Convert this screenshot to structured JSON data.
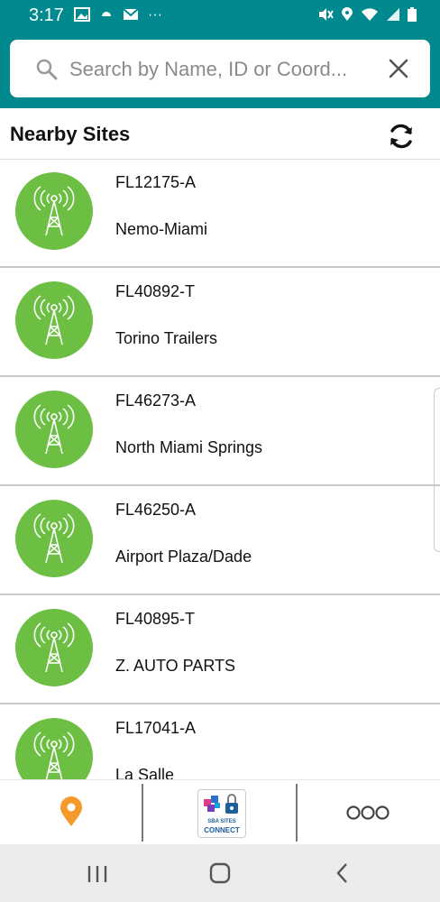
{
  "status_bar": {
    "time": "3:17",
    "dots": "···"
  },
  "search": {
    "placeholder": "Search by Name, ID or Coord..."
  },
  "header": {
    "title": "Nearby Sites"
  },
  "sites": [
    {
      "id": "FL12175-A",
      "name": "Nemo-Miami"
    },
    {
      "id": "FL40892-T",
      "name": "Torino Trailers"
    },
    {
      "id": "FL46273-A",
      "name": "North Miami Springs"
    },
    {
      "id": "FL46250-A",
      "name": "Airport Plaza/Dade"
    },
    {
      "id": "FL40895-T",
      "name": "Z. AUTO PARTS"
    },
    {
      "id": "FL17041-A",
      "name": "La Salle"
    }
  ],
  "nav": {
    "logo_line1": "SBA SITES",
    "logo_line2": "CONNECT"
  },
  "colors": {
    "teal": "#00898f",
    "site_green": "#6cbf43",
    "pin_orange": "#f39a2b"
  }
}
